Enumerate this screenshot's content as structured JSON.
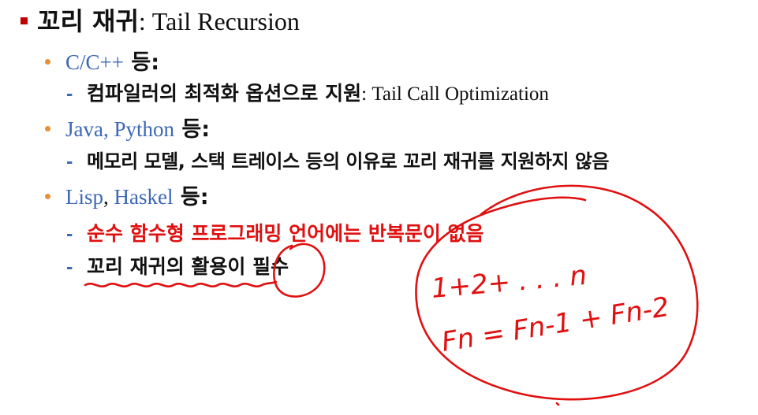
{
  "title": {
    "kr": "꼬리 재귀",
    "en": ": Tail Recursion"
  },
  "items": [
    {
      "lang_a": "C/C++",
      "lang_sep": "",
      "lang_b": "",
      "suffix": " 등:",
      "subs": [
        {
          "kr": "컴파일러의 최적화 옵션으로 지원",
          "en": ": Tail Call Optimization"
        }
      ]
    },
    {
      "lang_a": "Java, Python",
      "lang_sep": "",
      "lang_b": "",
      "suffix": " 등:",
      "subs": [
        {
          "kr": "메모리 모델, 스택 트레이스 등의 이유로 꼬리 재귀를 지원하지 않음",
          "en": ""
        }
      ]
    },
    {
      "lang_a": "Lisp",
      "lang_sep": ", ",
      "lang_b": "Haskel",
      "suffix": " 등:",
      "subs": [
        {
          "kr": "순수 함수형 프로그래밍 언어에는 반복문이 없음",
          "en": "",
          "color": "#e01010"
        },
        {
          "kr": "꼬리 재귀의 활용이 필수",
          "en": ""
        }
      ]
    }
  ],
  "annotations": {
    "line1": "1+2+ . . .  n",
    "line2": "Fn = Fn-1 + Fn-2",
    "ink_color": "#e01010"
  }
}
